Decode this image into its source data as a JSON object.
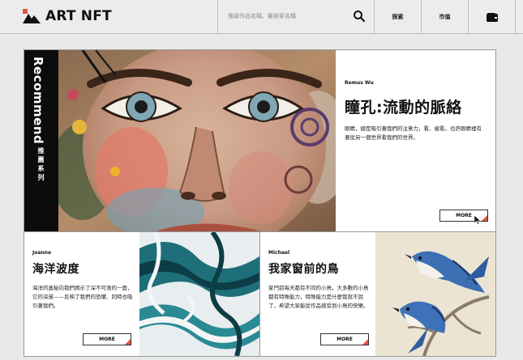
{
  "nav": {
    "logo_text": "ART NFT",
    "search_placeholder": "搜尋作品名稱、藝術家名稱",
    "explore": "探索",
    "market": "市值",
    "wallet_icon": "wallet-icon",
    "search_icon": "search-icon"
  },
  "hero": {
    "side_label": "Recommend",
    "side_label_cn": "推薦系列",
    "artist": "Remus Wu",
    "title": "瞳孔:流動的脈絡",
    "description": "眼睛，總是吸引著我們的注意力，看、被看，也許眼睛裡有著從另一個世界看我們的世界。",
    "more": "MORE"
  },
  "cards": [
    {
      "artist": "Joanne",
      "title": "海洋波度",
      "description": "海洋的奧秘向我們揭示了深不可測的一面，它的深邃——反映了我們的恐懼、同時也吸引著我們。",
      "more": "MORE"
    },
    {
      "artist": "Michael",
      "title": "我家窗前的鳥",
      "description": "家門前每天都有不同的小鳥，大多數的小鳥都有特殊能力，特殊能力是什麼我就不說了，希望大家能從作品感受到小鳥的快樂。",
      "more": "MORE"
    }
  ],
  "colors": {
    "accent": "#e3563c",
    "dark": "#0c0c0c",
    "background": "#e9e9e9"
  }
}
